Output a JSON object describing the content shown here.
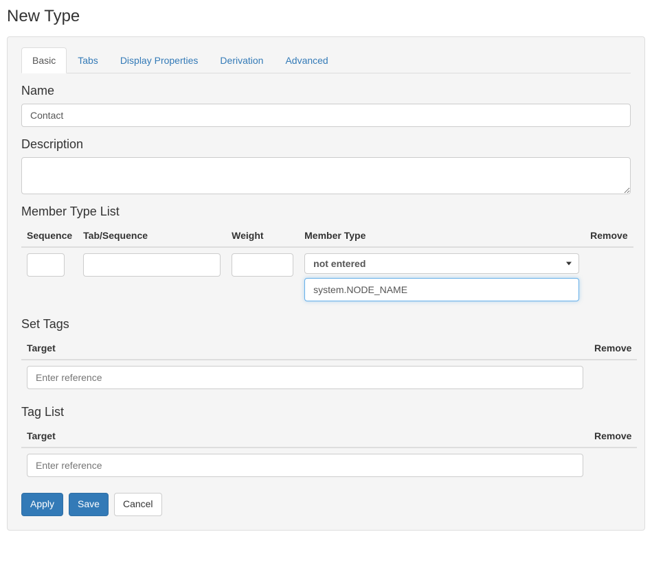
{
  "page": {
    "title": "New Type"
  },
  "tabs": [
    {
      "label": "Basic",
      "active": true
    },
    {
      "label": "Tabs"
    },
    {
      "label": "Display Properties"
    },
    {
      "label": "Derivation"
    },
    {
      "label": "Advanced"
    }
  ],
  "form": {
    "name_label": "Name",
    "name_value": "Contact",
    "description_label": "Description",
    "description_value": ""
  },
  "member_type_list": {
    "heading": "Member Type List",
    "columns": {
      "sequence": "Sequence",
      "tab_sequence": "Tab/Sequence",
      "weight": "Weight",
      "member_type": "Member Type",
      "remove": "Remove"
    },
    "row": {
      "sequence": "",
      "tab_sequence": "",
      "weight": "",
      "member_type_selected": "not entered",
      "member_type_filter": "system.NODE_NAME"
    }
  },
  "set_tags": {
    "heading": "Set Tags",
    "columns": {
      "target": "Target",
      "remove": "Remove"
    },
    "row": {
      "target_value": "",
      "target_placeholder": "Enter reference"
    }
  },
  "tag_list": {
    "heading": "Tag List",
    "columns": {
      "target": "Target",
      "remove": "Remove"
    },
    "row": {
      "target_value": "",
      "target_placeholder": "Enter reference"
    }
  },
  "buttons": {
    "apply": "Apply",
    "save": "Save",
    "cancel": "Cancel"
  }
}
